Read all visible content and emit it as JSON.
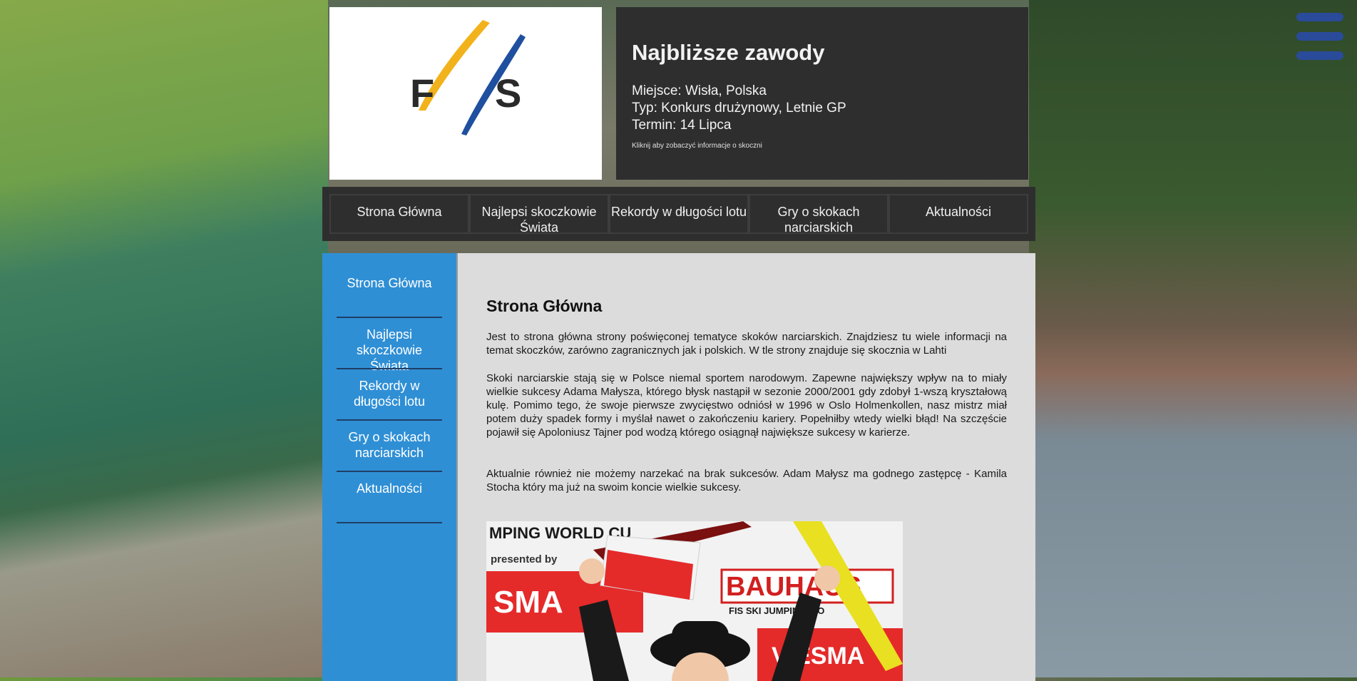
{
  "header": {
    "logo_text": "FIS",
    "upcoming_title": "Najbliższe zawody",
    "place": "Miejsce: Wisła, Polska",
    "type": "Typ: Konkurs drużynowy, Letnie GP",
    "date": "Termin: 14 Lipca",
    "hint": "Kliknij aby zobaczyć informacje o skoczni"
  },
  "topnav": {
    "items": [
      {
        "label": "Strona Główna"
      },
      {
        "label": "Najlepsi skoczkowie Świata"
      },
      {
        "label": "Rekordy w długości lotu"
      },
      {
        "label": "Gry o skokach narciarskich"
      },
      {
        "label": "Aktualności"
      }
    ]
  },
  "sidebar": {
    "items": [
      {
        "label": "Strona Główna"
      },
      {
        "label": "Najlepsi skoczkowie Świata"
      },
      {
        "label": "Rekordy w długości lotu"
      },
      {
        "label": "Gry o skokach narciarskich"
      },
      {
        "label": "Aktualności"
      }
    ]
  },
  "main": {
    "title": "Strona Główna",
    "p1": "Jest to strona główna strony poświęconej tematyce skoków narciarskich. Znajdziesz tu wiele informacji na temat skoczków, zarówno zagranicznych jak i polskich. W tle strony znajduje się skocznia w Lahti",
    "p2": "Skoki narciarskie stają się w Polsce niemal sportem narodowym. Zapewne największy wpływ na to miały wielkie sukcesy Adama Małysza, którego błysk nastąpił w sezonie 2000/2001 gdy zdobył 1-wszą kryształową kulę. Pomimo tego, że swoje pierwsze zwycięstwo odniósł w 1996 w Oslo Holmenkollen, nasz mistrz miał potem duży spadek formy i myślał nawet o zakończeniu kariery. Popełniłby wtedy wielki błąd! Na szczęście pojawił się Apoloniusz Tajner pod wodzą którego osiągnął największe sukcesy w karierze.",
    "p3": "Aktualnie również nie możemy narzekać na brak sukcesów. Adam Małysz ma godnego zastępcę - Kamila Stocha który ma już na swoim koncie wielkie sukcesy.",
    "photo_banner_top": "MPING WORLD CU",
    "photo_presented": "presented by",
    "photo_bauhaus": "BAUHAUS",
    "photo_fis": "FIS SKI JUMPING WO",
    "photo_sponsor_left": "SMA",
    "photo_sponsor_right": "VIESMA"
  },
  "colors": {
    "sidebar_blue": "#2f8fd5",
    "dark_panel": "#2e2e2e",
    "content_bg": "#dcdcdc",
    "hamburger": "#2a4a9a",
    "fis_yellow": "#f2b21b",
    "fis_blue": "#1f4f9f"
  },
  "icons": {
    "menu": "hamburger-icon"
  }
}
